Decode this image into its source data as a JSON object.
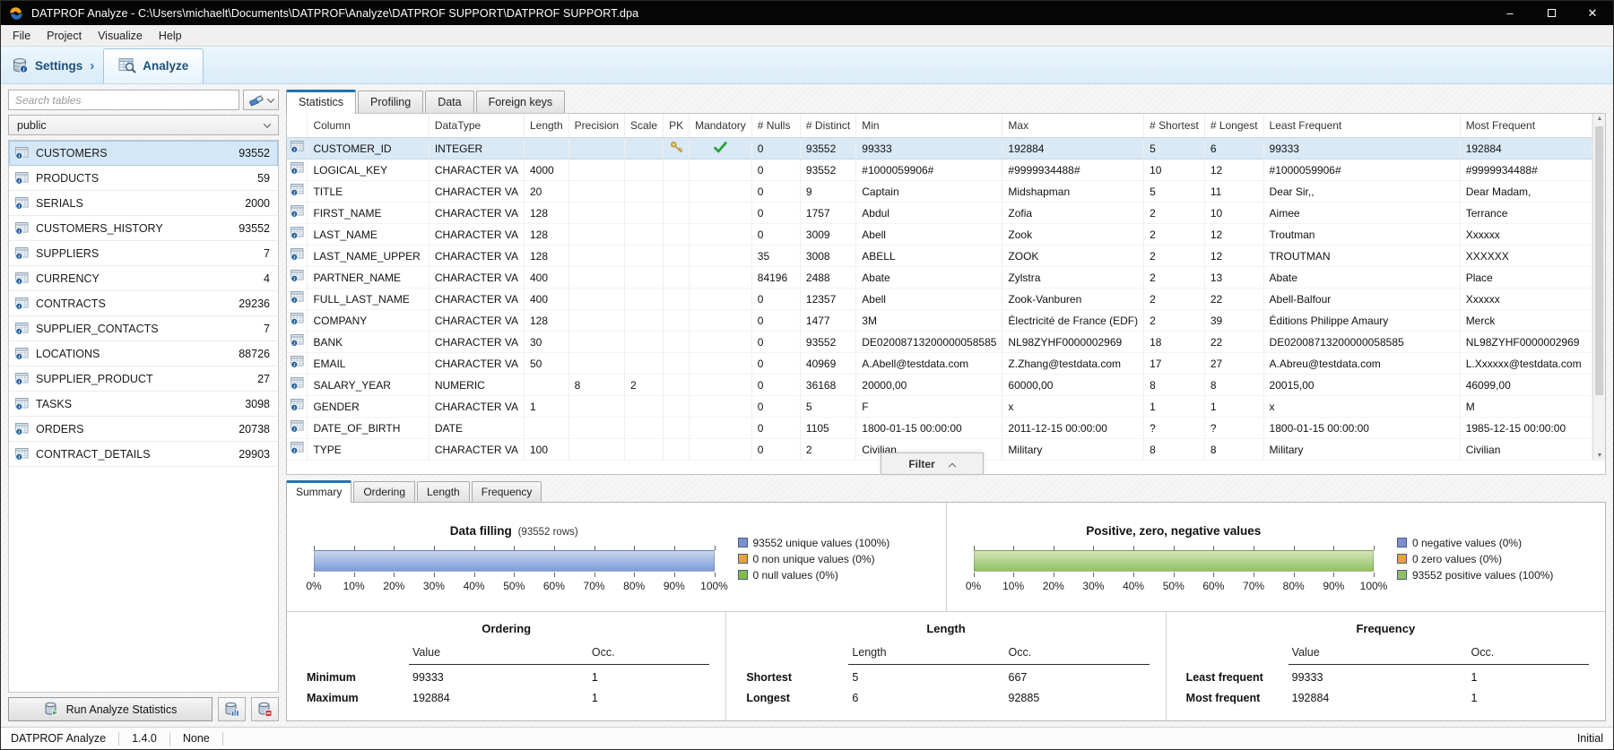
{
  "window": {
    "title": "DATPROF Analyze - C:\\Users\\michaelt\\Documents\\DATPROF\\Analyze\\DATPROF SUPPORT\\DATPROF SUPPORT.dpa",
    "minimize": "–",
    "close": "✕"
  },
  "menu": [
    "File",
    "Project",
    "Visualize",
    "Help"
  ],
  "nav": {
    "settings": "Settings",
    "arrow": "›",
    "analyze": "Analyze"
  },
  "sidebar": {
    "search_placeholder": "Search tables",
    "schema": "public",
    "tables": [
      {
        "name": "CUSTOMERS",
        "rows": "93552",
        "selected": true
      },
      {
        "name": "PRODUCTS",
        "rows": "59"
      },
      {
        "name": "SERIALS",
        "rows": "2000"
      },
      {
        "name": "CUSTOMERS_HISTORY",
        "rows": "93552"
      },
      {
        "name": "SUPPLIERS",
        "rows": "7"
      },
      {
        "name": "CURRENCY",
        "rows": "4"
      },
      {
        "name": "CONTRACTS",
        "rows": "29236"
      },
      {
        "name": "SUPPLIER_CONTACTS",
        "rows": "7"
      },
      {
        "name": "LOCATIONS",
        "rows": "88726"
      },
      {
        "name": "SUPPLIER_PRODUCT",
        "rows": "27"
      },
      {
        "name": "TASKS",
        "rows": "3098"
      },
      {
        "name": "ORDERS",
        "rows": "20738"
      },
      {
        "name": "CONTRACT_DETAILS",
        "rows": "29903"
      }
    ],
    "run_button": "Run Analyze Statistics"
  },
  "main_tabs": {
    "items": [
      "Statistics",
      "Profiling",
      "Data",
      "Foreign keys"
    ],
    "active": 0
  },
  "stats_table": {
    "headers": [
      "",
      "Column",
      "DataType",
      "Length",
      "Precision",
      "Scale",
      "PK",
      "Mandatory",
      "# Nulls",
      "# Distinct",
      "Min",
      "Max",
      "# Shortest",
      "# Longest",
      "Least Frequent",
      "Most Frequent"
    ],
    "rows": [
      {
        "column": "CUSTOMER_ID",
        "datatype": "INTEGER",
        "length": "",
        "precision": "",
        "scale": "",
        "pk": true,
        "mandatory": true,
        "nulls": "0",
        "distinct": "93552",
        "min": "99333",
        "max": "192884",
        "shortest": "5",
        "longest": "6",
        "least": "99333",
        "most": "192884",
        "selected": true
      },
      {
        "column": "LOGICAL_KEY",
        "datatype": "CHARACTER VA",
        "length": "4000",
        "precision": "",
        "scale": "",
        "pk": false,
        "mandatory": false,
        "nulls": "0",
        "distinct": "93552",
        "min": "#1000059906#",
        "max": "#9999934488#",
        "shortest": "10",
        "longest": "12",
        "least": "#1000059906#",
        "most": "#9999934488#"
      },
      {
        "column": "TITLE",
        "datatype": "CHARACTER VA",
        "length": "20",
        "precision": "",
        "scale": "",
        "pk": false,
        "mandatory": false,
        "nulls": "0",
        "distinct": "9",
        "min": "Captain",
        "max": "Midshapman",
        "shortest": "5",
        "longest": "11",
        "least": "Dear Sir,,",
        "most": "Dear Madam,"
      },
      {
        "column": "FIRST_NAME",
        "datatype": "CHARACTER VA",
        "length": "128",
        "precision": "",
        "scale": "",
        "pk": false,
        "mandatory": false,
        "nulls": "0",
        "distinct": "1757",
        "min": "Abdul",
        "max": "Zofia",
        "shortest": "2",
        "longest": "10",
        "least": "Aimee",
        "most": "Terrance"
      },
      {
        "column": "LAST_NAME",
        "datatype": "CHARACTER VA",
        "length": "128",
        "precision": "",
        "scale": "",
        "pk": false,
        "mandatory": false,
        "nulls": "0",
        "distinct": "3009",
        "min": "Abell",
        "max": "Zook",
        "shortest": "2",
        "longest": "12",
        "least": "Troutman",
        "most": "Xxxxxx"
      },
      {
        "column": "LAST_NAME_UPPER",
        "datatype": "CHARACTER VA",
        "length": "128",
        "precision": "",
        "scale": "",
        "pk": false,
        "mandatory": false,
        "nulls": "35",
        "distinct": "3008",
        "min": "ABELL",
        "max": "ZOOK",
        "shortest": "2",
        "longest": "12",
        "least": "TROUTMAN",
        "most": "XXXXXX"
      },
      {
        "column": "PARTNER_NAME",
        "datatype": "CHARACTER VA",
        "length": "400",
        "precision": "",
        "scale": "",
        "pk": false,
        "mandatory": false,
        "nulls": "84196",
        "distinct": "2488",
        "min": "Abate",
        "max": "Zylstra",
        "shortest": "2",
        "longest": "13",
        "least": "Abate",
        "most": "Place"
      },
      {
        "column": "FULL_LAST_NAME",
        "datatype": "CHARACTER VA",
        "length": "400",
        "precision": "",
        "scale": "",
        "pk": false,
        "mandatory": false,
        "nulls": "0",
        "distinct": "12357",
        "min": "Abell",
        "max": "Zook-Vanburen",
        "shortest": "2",
        "longest": "22",
        "least": "Abell-Balfour",
        "most": "Xxxxxx"
      },
      {
        "column": "COMPANY",
        "datatype": "CHARACTER VA",
        "length": "128",
        "precision": "",
        "scale": "",
        "pk": false,
        "mandatory": false,
        "nulls": "0",
        "distinct": "1477",
        "min": "3M",
        "max": "Électricité de France (EDF)",
        "shortest": "2",
        "longest": "39",
        "least": "Éditions Philippe Amaury",
        "most": "Merck"
      },
      {
        "column": "BANK",
        "datatype": "CHARACTER VA",
        "length": "30",
        "precision": "",
        "scale": "",
        "pk": false,
        "mandatory": false,
        "nulls": "0",
        "distinct": "93552",
        "min": "DE02008713200000058585",
        "max": "NL98ZYHF0000002969",
        "shortest": "18",
        "longest": "22",
        "least": "DE02008713200000058585",
        "most": "NL98ZYHF0000002969"
      },
      {
        "column": "EMAIL",
        "datatype": "CHARACTER VA",
        "length": "50",
        "precision": "",
        "scale": "",
        "pk": false,
        "mandatory": false,
        "nulls": "0",
        "distinct": "40969",
        "min": "A.Abell@testdata.com",
        "max": "Z.Zhang@testdata.com",
        "shortest": "17",
        "longest": "27",
        "least": "A.Abreu@testdata.com",
        "most": "L.Xxxxxx@testdata.com"
      },
      {
        "column": "SALARY_YEAR",
        "datatype": "NUMERIC",
        "length": "",
        "precision": "8",
        "scale": "2",
        "pk": false,
        "mandatory": false,
        "nulls": "0",
        "distinct": "36168",
        "min": "20000,00",
        "max": "60000,00",
        "shortest": "8",
        "longest": "8",
        "least": "20015,00",
        "most": "46099,00"
      },
      {
        "column": "GENDER",
        "datatype": "CHARACTER VA",
        "length": "1",
        "precision": "",
        "scale": "",
        "pk": false,
        "mandatory": false,
        "nulls": "0",
        "distinct": "5",
        "min": "F",
        "max": "x",
        "shortest": "1",
        "longest": "1",
        "least": "x",
        "most": "M"
      },
      {
        "column": "DATE_OF_BIRTH",
        "datatype": "DATE",
        "length": "",
        "precision": "",
        "scale": "",
        "pk": false,
        "mandatory": false,
        "nulls": "0",
        "distinct": "1105",
        "min": "1800-01-15 00:00:00",
        "max": "2011-12-15 00:00:00",
        "shortest": "?",
        "longest": "?",
        "least": "1800-01-15 00:00:00",
        "most": "1985-12-15 00:00:00"
      },
      {
        "column": "TYPE",
        "datatype": "CHARACTER VA",
        "length": "100",
        "precision": "",
        "scale": "",
        "pk": false,
        "mandatory": false,
        "nulls": "0",
        "distinct": "2",
        "min": "Civilian",
        "max": "Military",
        "shortest": "8",
        "longest": "8",
        "least": "Military",
        "most": "Civilian"
      }
    ]
  },
  "filter_button": "Filter",
  "bottom_tabs": {
    "items": [
      "Summary",
      "Ordering",
      "Length",
      "Frequency"
    ],
    "active": 0
  },
  "chart_data": [
    {
      "type": "bar",
      "orientation": "horizontal",
      "title": "Data filling",
      "subtitle": "(93552 rows)",
      "xlim": [
        0,
        100
      ],
      "ticks": [
        "0%",
        "10%",
        "20%",
        "30%",
        "40%",
        "50%",
        "60%",
        "70%",
        "80%",
        "90%",
        "100%"
      ],
      "bar_value": 100,
      "bar_color_top": "#c7d6ee",
      "bar_color_bottom": "#7e9dd8",
      "series": [
        {
          "name": "93552 unique values (100%)",
          "count": 93552,
          "value": 100,
          "color": "#7b90cd"
        },
        {
          "name": "0 non unique values (0%)",
          "count": 0,
          "value": 0,
          "color": "#e8a23c"
        },
        {
          "name": "0 null values (0%)",
          "count": 0,
          "value": 0,
          "color": "#84b94f"
        }
      ]
    },
    {
      "type": "bar",
      "orientation": "horizontal",
      "title": "Positive, zero, negative values",
      "subtitle": "",
      "xlim": [
        0,
        100
      ],
      "ticks": [
        "0%",
        "10%",
        "20%",
        "30%",
        "40%",
        "50%",
        "60%",
        "70%",
        "80%",
        "90%",
        "100%"
      ],
      "bar_value": 100,
      "bar_color_top": "#d3e6ba",
      "bar_color_bottom": "#92c161",
      "series": [
        {
          "name": "0 negative values (0%)",
          "count": 0,
          "value": 0,
          "color": "#7b90cd"
        },
        {
          "name": "0 zero values (0%)",
          "count": 0,
          "value": 0,
          "color": "#e8a23c"
        },
        {
          "name": "93552 positive values (100%)",
          "count": 93552,
          "value": 100,
          "color": "#92c161"
        }
      ]
    }
  ],
  "mini_panels": [
    {
      "title": "Ordering",
      "col1": "Value",
      "col2": "Occ.",
      "rows": [
        [
          "Minimum",
          "99333",
          "1"
        ],
        [
          "Maximum",
          "192884",
          "1"
        ]
      ]
    },
    {
      "title": "Length",
      "col1": "Length",
      "col2": "Occ.",
      "rows": [
        [
          "Shortest",
          "5",
          "667"
        ],
        [
          "Longest",
          "6",
          "92885"
        ]
      ]
    },
    {
      "title": "Frequency",
      "col1": "Value",
      "col2": "Occ.",
      "rows": [
        [
          "Least frequent",
          "99333",
          "1"
        ],
        [
          "Most frequent",
          "192884",
          "1"
        ]
      ]
    }
  ],
  "statusbar": {
    "app": "DATPROF Analyze",
    "version": "1.4.0",
    "mode": "None",
    "state": "Initial"
  },
  "colors": {
    "accent_blue": "#2173b4",
    "selection": "#d9e9f6",
    "titlebar": "#060606"
  }
}
